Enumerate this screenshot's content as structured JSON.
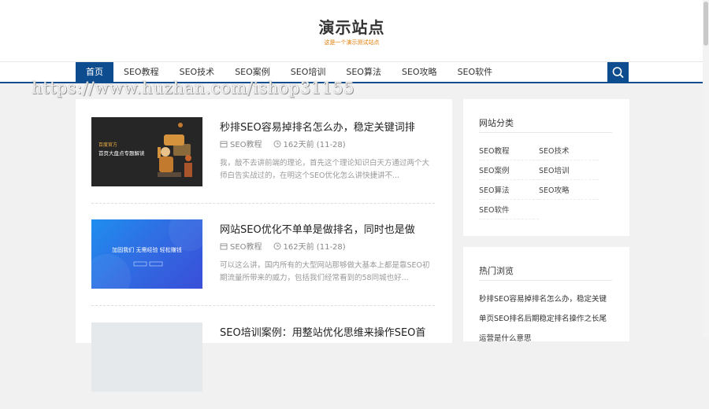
{
  "site": {
    "title": "演示站点",
    "subtitle": "这是一个演示测试站点"
  },
  "nav": {
    "items": [
      {
        "label": "首页",
        "active": true
      },
      {
        "label": "SEO教程"
      },
      {
        "label": "SEO技术"
      },
      {
        "label": "SEO案例"
      },
      {
        "label": "SEO培训"
      },
      {
        "label": "SEO算法"
      },
      {
        "label": "SEO攻略"
      },
      {
        "label": "SEO软件"
      }
    ],
    "search_icon": "search-icon",
    "accent_color": "#0d4c8f"
  },
  "watermark": "https://www.huzhan.com/ishop31155",
  "posts": [
    {
      "title": "秒排SEO容易掉排名怎么办，稳定关键词排",
      "category": "SEO教程",
      "time": "162天前 (11-28)",
      "excerpt": "我，敲不去讲前端的理论，首先这个理论知识白天方通过两个大师白告实战过的，在明这个SEO优化怎么讲快捷讲不...",
      "thumb_text": [
        "百度官方",
        "首页大盘点专题解读"
      ]
    },
    {
      "title": "网站SEO优化不单单是做排名，同时也是做",
      "category": "SEO教程",
      "time": "162天前 (11-28)",
      "excerpt": "可以这么讲，国内所有的大型网站那够做大基本上都是靠SEO初期流量所带来的威力，包括我们经常看到的58同城也好...",
      "thumb_text": [
        "加固我们 无需经验 轻松赚钱"
      ]
    },
    {
      "title": "SEO培训案例：用整站优化思维来操作SEO首",
      "category": "",
      "time": "",
      "excerpt": "",
      "thumb_text": []
    }
  ],
  "sidebar": {
    "categories_title": "网站分类",
    "categories": [
      "SEO教程",
      "SEO技术",
      "SEO案例",
      "SEO培训",
      "SEO算法",
      "SEO攻略",
      "SEO软件"
    ],
    "hot_title": "热门浏览",
    "hot_items": [
      "秒排SEO容易掉排名怎么办，稳定关键",
      "单页SEO排名后期稳定排名操作之长尾",
      "运营是什么意思"
    ]
  }
}
